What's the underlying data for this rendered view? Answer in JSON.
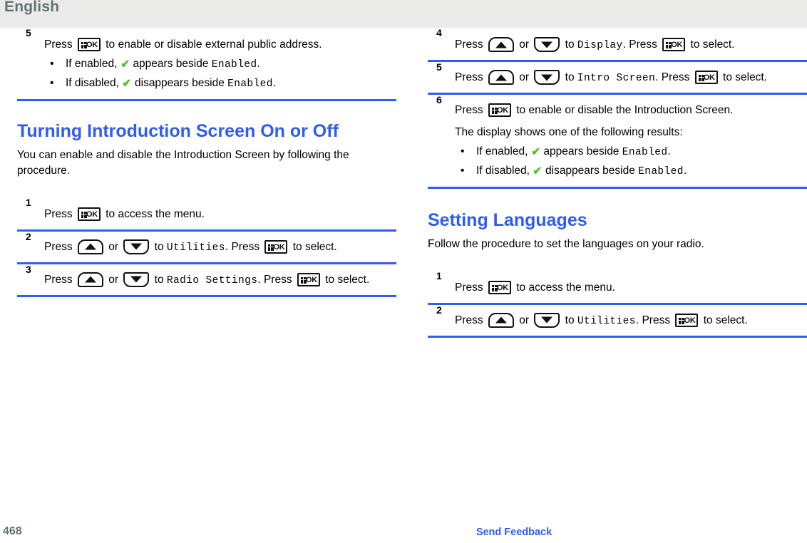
{
  "header": {
    "language": "English"
  },
  "footer": {
    "page_number": "468",
    "feedback_link": "Send Feedback"
  },
  "colors": {
    "accent_blue": "#2f5cf5",
    "header_gray_text": "#5f7379",
    "header_band": "#ebebe9",
    "check_green": "#4cc21f"
  },
  "left_column": {
    "step5": {
      "number": "5",
      "text_before_key": "Press",
      "text_after_key": "to enable or disable external public address.",
      "bullets": [
        {
          "prefix": "If enabled,",
          "middle": "appears beside",
          "mono": "Enabled",
          "suffix": "."
        },
        {
          "prefix": "If disabled,",
          "middle": "disappears beside",
          "mono": "Enabled",
          "suffix": "."
        }
      ]
    },
    "section": {
      "title": "Turning Introduction Screen On or Off",
      "intro": "You can enable and disable the Introduction Screen by following the procedure."
    },
    "steps": [
      {
        "number": "1",
        "text_before_key": "Press",
        "text_after_key": "to access the menu."
      },
      {
        "number": "2",
        "text_press": "Press",
        "text_or": "or",
        "text_to": "to",
        "mono": "Utilities",
        "text_period": ".",
        "text_press2": "Press",
        "text_end": "to select."
      },
      {
        "number": "3",
        "text_press": "Press",
        "text_or": "or",
        "text_to": "to",
        "mono": "Radio Settings",
        "text_period": ".",
        "text_press2": "Press",
        "text_end": "to select."
      }
    ]
  },
  "right_column": {
    "steps": [
      {
        "number": "4",
        "text_press": "Press",
        "text_or": "or",
        "text_to": "to",
        "mono": "Display",
        "text_period": ".",
        "text_press2": "Press",
        "text_end": "to select."
      },
      {
        "number": "5",
        "text_press": "Press",
        "text_or": "or",
        "text_to": "to",
        "mono": "Intro Screen",
        "text_period": ".",
        "text_press2": "Press",
        "text_end": "to select."
      },
      {
        "number": "6",
        "text_before_key": "Press",
        "text_after_key": "to enable or disable the Introduction Screen.",
        "result_intro": "The display shows one of the following results:",
        "bullets": [
          {
            "prefix": "If enabled,",
            "middle": "appears beside",
            "mono": "Enabled",
            "suffix": "."
          },
          {
            "prefix": "If disabled,",
            "middle": "disappears beside",
            "mono": "Enabled",
            "suffix": "."
          }
        ]
      }
    ],
    "section": {
      "title": "Setting Languages",
      "intro": "Follow the procedure to set the languages on your radio."
    },
    "lang_steps": [
      {
        "number": "1",
        "text_before_key": "Press",
        "text_after_key": "to access the menu."
      },
      {
        "number": "2",
        "text_press": "Press",
        "text_or": "or",
        "text_to": "to",
        "mono": "Utilities",
        "text_period": ".",
        "text_press2": "Press",
        "text_end": "to select."
      }
    ]
  },
  "icons": {
    "ok_key": "menu-ok-key",
    "up_key": "up-arrow-key",
    "down_key": "down-arrow-key",
    "check": "green-check-icon"
  }
}
